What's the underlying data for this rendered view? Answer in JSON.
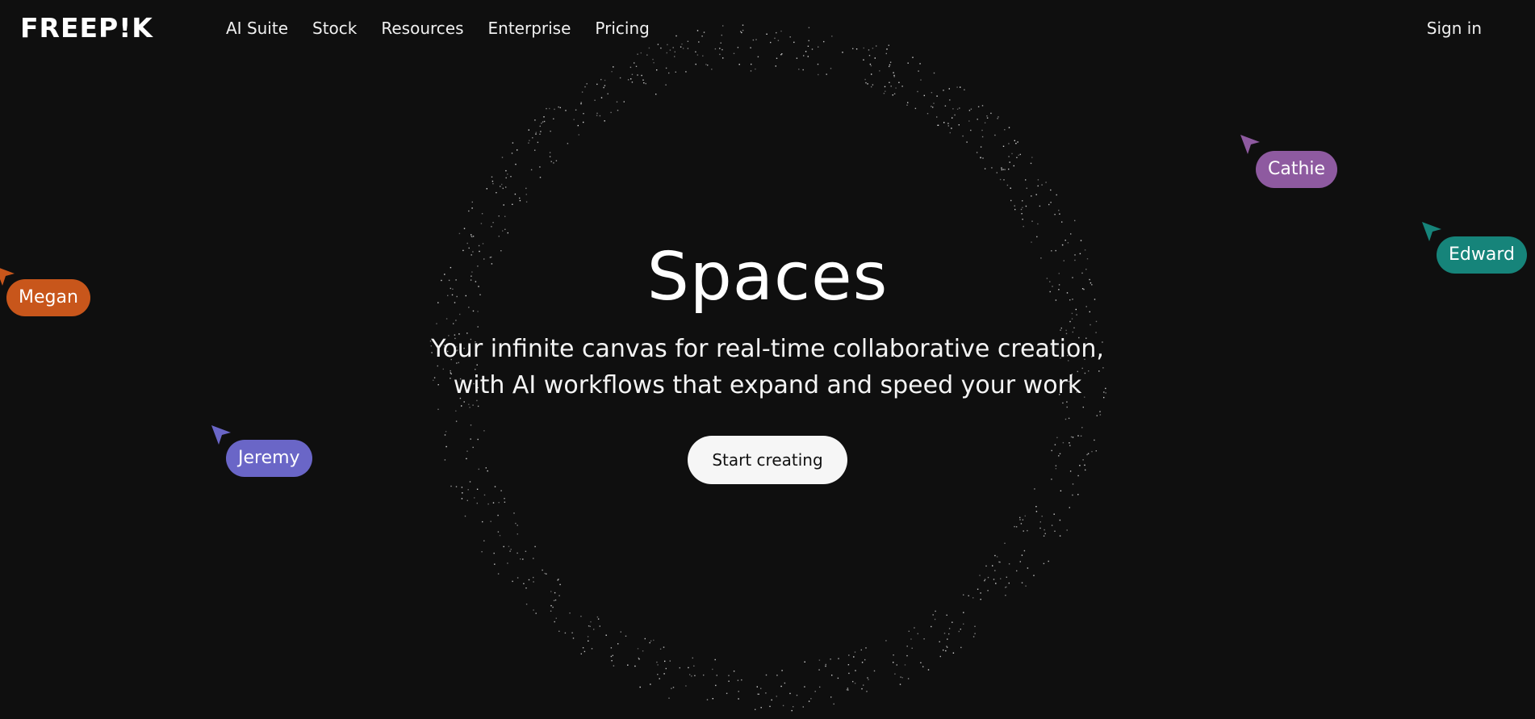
{
  "header": {
    "logo": "FREEP!K",
    "nav": [
      "AI Suite",
      "Stock",
      "Resources",
      "Enterprise",
      "Pricing"
    ],
    "signin": "Sign in"
  },
  "hero": {
    "title": "Spaces",
    "subtitle_line1": "Your infinite canvas for real-time collaborative creation,",
    "subtitle_line2": "with AI workflows that expand and speed your work",
    "cta": "Start creating"
  },
  "cursors": [
    {
      "name": "Megan",
      "color": "#c8561b"
    },
    {
      "name": "Jeremy",
      "color": "#6a66c7"
    },
    {
      "name": "Cathie",
      "color": "#8e5aa0"
    },
    {
      "name": "Edward",
      "color": "#16847a"
    }
  ],
  "colors": {
    "background": "#0f0f0f",
    "text": "#ffffff",
    "button_bg": "#f6f6f6",
    "button_text": "#111111"
  },
  "icons": [
    "cursor-arrow-icon"
  ]
}
